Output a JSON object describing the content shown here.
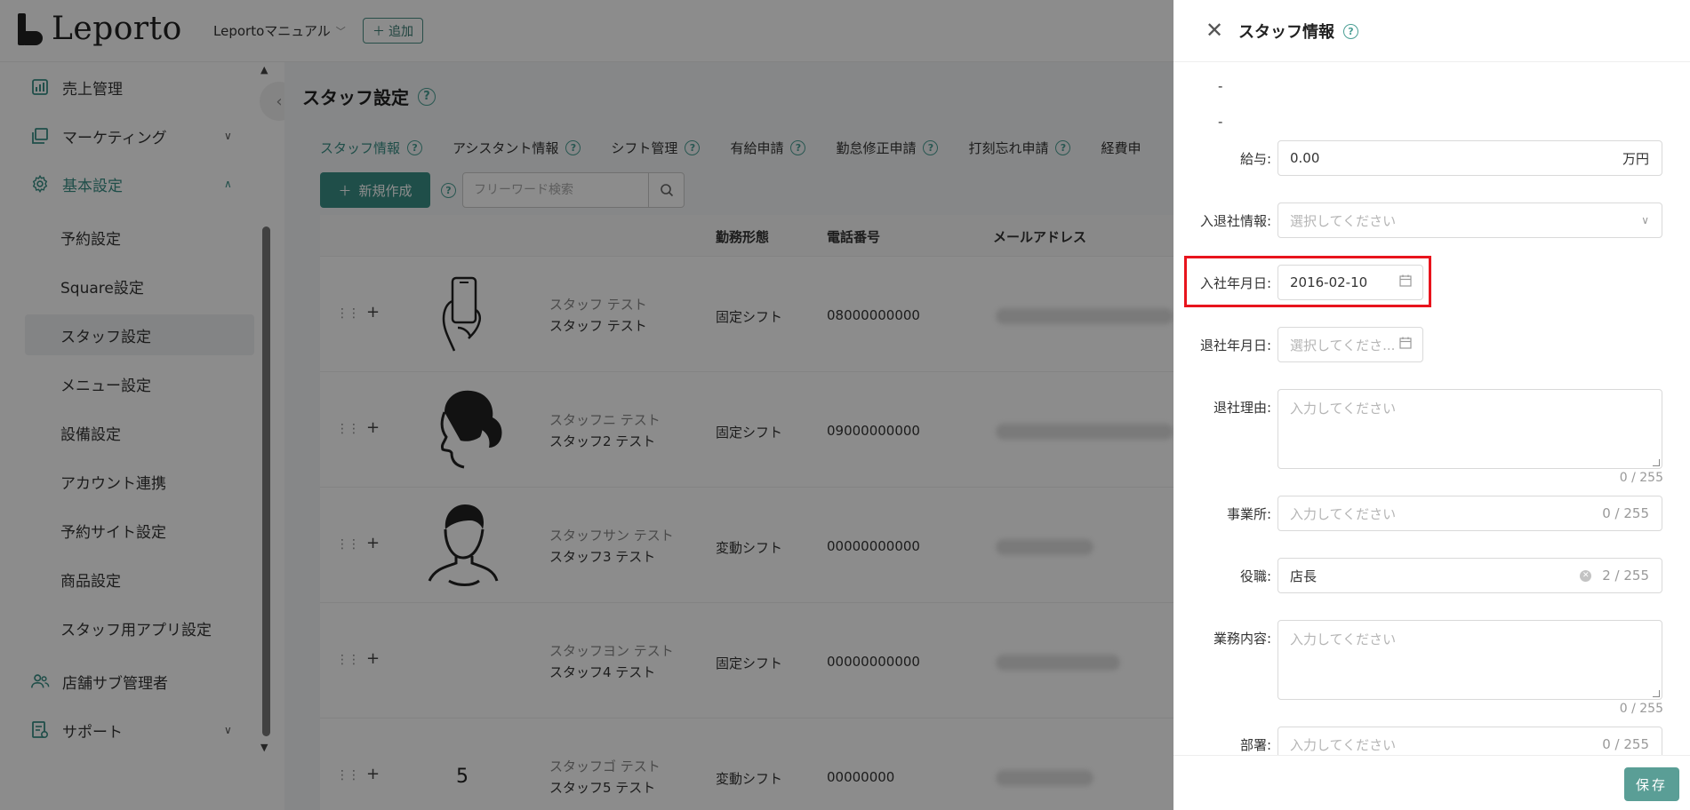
{
  "header": {
    "logo_text": "Leporto",
    "store_select": "Leportoマニュアル",
    "add_label": "追加"
  },
  "sidebar": {
    "items": [
      {
        "label": "売上管理",
        "icon": "chart-icon"
      },
      {
        "label": "マーケティング",
        "icon": "copy-icon"
      },
      {
        "label": "基本設定",
        "icon": "gear-icon"
      },
      {
        "label": "店舗サブ管理者",
        "icon": "users-icon"
      },
      {
        "label": "サポート",
        "icon": "support-icon"
      }
    ],
    "sub_items": [
      "予約設定",
      "Square設定",
      "スタッフ設定",
      "メニュー設定",
      "設備設定",
      "アカウント連携",
      "予約サイト設定",
      "商品設定",
      "スタッフ用アプリ設定"
    ],
    "selected_sub": "スタッフ設定"
  },
  "main": {
    "page_title": "スタッフ設定",
    "tabs": [
      "スタッフ情報",
      "アシスタント情報",
      "シフト管理",
      "有給申請",
      "勤怠修正申請",
      "打刻忘れ申請",
      "経費申"
    ],
    "active_tab": "スタッフ情報",
    "new_button": "新規作成",
    "search_placeholder": "フリーワード検索",
    "columns": [
      "勤務形態",
      "電話番号",
      "メールアドレス"
    ],
    "rows": [
      {
        "kana": "スタッフ テスト",
        "name": "スタッフ テスト",
        "shift": "固定シフト",
        "phone": "08000000000",
        "avatar": "phone-hand"
      },
      {
        "kana": "スタッフニ テスト",
        "name": "スタッフ2 テスト",
        "shift": "固定シフト",
        "phone": "09000000000",
        "avatar": "woman"
      },
      {
        "kana": "スタッフサン テスト",
        "name": "スタッフ3 テスト",
        "shift": "変動シフト",
        "phone": "00000000000",
        "avatar": "man"
      },
      {
        "kana": "スタッフヨン テスト",
        "name": "スタッフ4 テスト",
        "shift": "固定シフト",
        "phone": "00000000000",
        "avatar": "none"
      },
      {
        "kana": "スタッフゴ テスト",
        "name": "スタッフ5 テスト",
        "shift": "変動シフト",
        "phone": "00000000",
        "avatar": "5"
      }
    ]
  },
  "drawer": {
    "title": "スタッフ情報",
    "dash1": "-",
    "dash2": "-",
    "salary": {
      "label": "給与:",
      "value": "0.00",
      "suffix": "万円"
    },
    "employment": {
      "label": "入退社情報:",
      "placeholder": "選択してください"
    },
    "join_date": {
      "label": "入社年月日:",
      "value": "2016-02-10"
    },
    "leave_date": {
      "label": "退社年月日:",
      "placeholder": "選択してくださ..."
    },
    "leave_reason": {
      "label": "退社理由:",
      "placeholder": "入力してください",
      "count": "0 / 255"
    },
    "office": {
      "label": "事業所:",
      "placeholder": "入力してください",
      "count": "0 / 255"
    },
    "position": {
      "label": "役職:",
      "value": "店長",
      "count": "2 / 255"
    },
    "duties": {
      "label": "業務内容:",
      "placeholder": "入力してください",
      "count": "0 / 255"
    },
    "department": {
      "label": "部署:",
      "placeholder": "入力してください",
      "count": "0 / 255"
    },
    "save": "保存"
  },
  "colors": {
    "accent": "#3a8f86",
    "highlight": "#e8141d"
  }
}
